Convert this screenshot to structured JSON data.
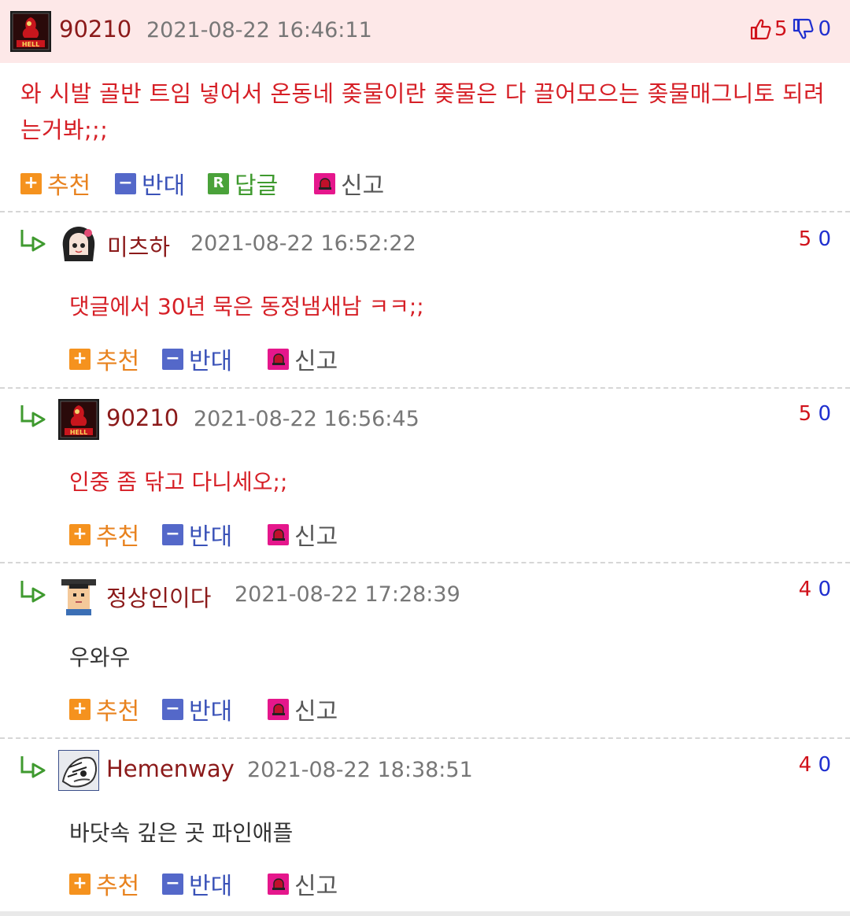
{
  "post": {
    "author": "90210",
    "timestamp": "2021-08-22 16:46:11",
    "upvotes": "5",
    "downvotes": "0",
    "text": "와 시발 골반 트임 넣어서 온동네 좆물이란 좆물은 다 끌어모으는 좆물매그니토 되려는거봐;;;",
    "actions": {
      "recommend": "추천",
      "oppose": "반대",
      "reply": "답글",
      "report": "신고"
    }
  },
  "comments": [
    {
      "author": "미츠하",
      "timestamp": "2021-08-22 16:52:22",
      "up": "5",
      "down": "0",
      "text": "댓글에서 30년 묵은 동정냄새남 ㅋㅋ;;"
    },
    {
      "author": "90210",
      "timestamp": "2021-08-22 16:56:45",
      "up": "5",
      "down": "0",
      "text": "인중 좀 닦고 다니세오;;"
    },
    {
      "author": "정상인이다",
      "timestamp": "2021-08-22 17:28:39",
      "up": "4",
      "down": "0",
      "text": "우와우"
    },
    {
      "author": "Hemenway",
      "timestamp": "2021-08-22 18:38:51",
      "up": "4",
      "down": "0",
      "text": "바닷속 깊은 곳 파인애플"
    }
  ],
  "comment_actions": {
    "recommend": "추천",
    "oppose": "반대",
    "report": "신고"
  },
  "colors": {
    "header_bg": "#fde8e8",
    "nick": "#8b1a1a",
    "text_red": "#d61f26",
    "up": "#d0121b",
    "down": "#1f2fcf"
  },
  "icons": [
    "thumbs-up-icon",
    "thumbs-down-icon",
    "plus-icon",
    "minus-icon",
    "reply-icon",
    "siren-icon",
    "reply-arrow-icon"
  ]
}
